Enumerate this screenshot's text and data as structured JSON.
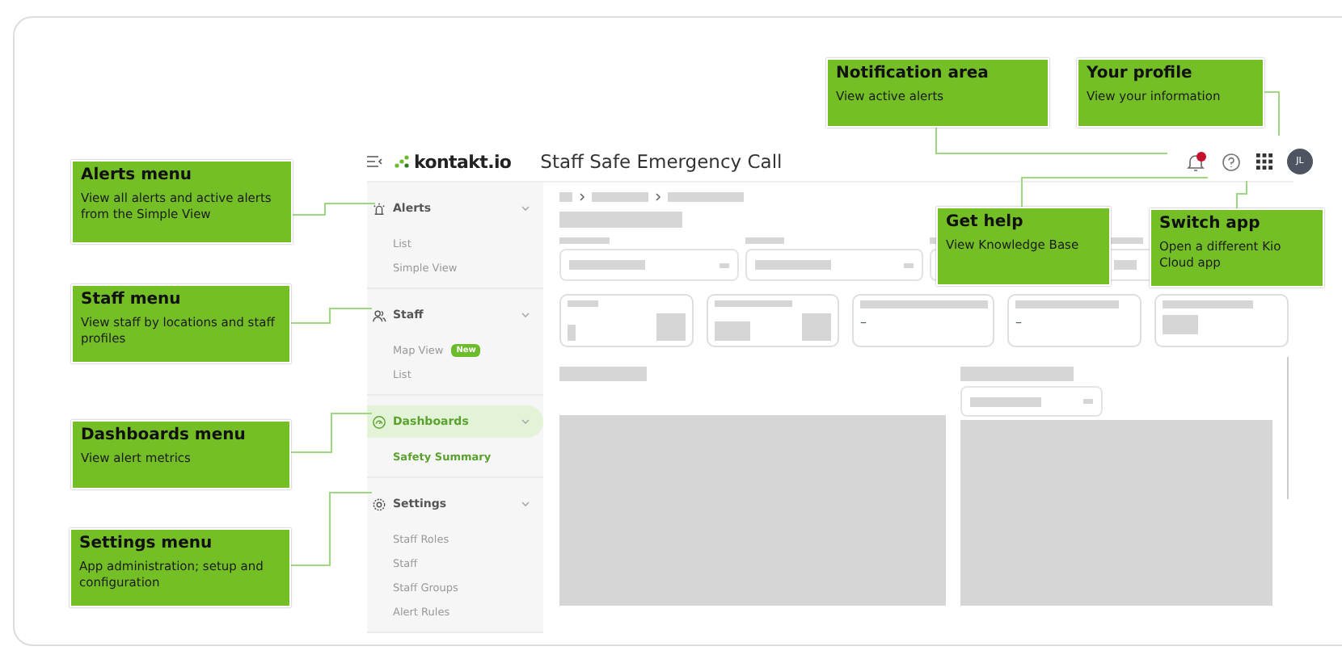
{
  "header": {
    "brand": "kontakt.io",
    "title": "Staff Safe Emergency Call",
    "avatar": "JL"
  },
  "sidebar": {
    "groups": [
      {
        "label": "Alerts",
        "selected": false,
        "items": [
          {
            "label": "List",
            "selected": false
          },
          {
            "label": "Simple View",
            "selected": false
          }
        ]
      },
      {
        "label": "Staff",
        "selected": false,
        "items": [
          {
            "label": "Map View",
            "badge": "New",
            "selected": false
          },
          {
            "label": "List",
            "selected": false
          }
        ]
      },
      {
        "label": "Dashboards",
        "selected": true,
        "items": [
          {
            "label": "Safety Summary",
            "selected": true
          }
        ]
      },
      {
        "label": "Settings",
        "selected": false,
        "items": [
          {
            "label": "Staff Roles",
            "selected": false
          },
          {
            "label": "Staff",
            "selected": false
          },
          {
            "label": "Staff Groups",
            "selected": false
          },
          {
            "label": "Alert Rules",
            "selected": false
          }
        ]
      }
    ]
  },
  "stat_cards": [
    {
      "kind": "loading"
    },
    {
      "kind": "loading"
    },
    {
      "kind": "value",
      "value": "–"
    },
    {
      "kind": "value",
      "value": "–"
    },
    {
      "kind": "loading"
    }
  ],
  "callouts": [
    {
      "title": "Notification area",
      "description": "View active alerts"
    },
    {
      "title": "Your profile",
      "description": "View your information"
    },
    {
      "title": "Alerts menu",
      "description": "View all alerts and active alerts from the Simple View"
    },
    {
      "title": "Get help",
      "description": "View Knowledge Base"
    },
    {
      "title": "Switch app",
      "description": "Open a different Kio Cloud app"
    },
    {
      "title": "Staff menu",
      "description": "View staff by locations and staff profiles"
    },
    {
      "title": "Dashboards menu",
      "description": "View alert metrics"
    },
    {
      "title": "Settings menu",
      "description": "App administration; setup and configuration"
    }
  ]
}
